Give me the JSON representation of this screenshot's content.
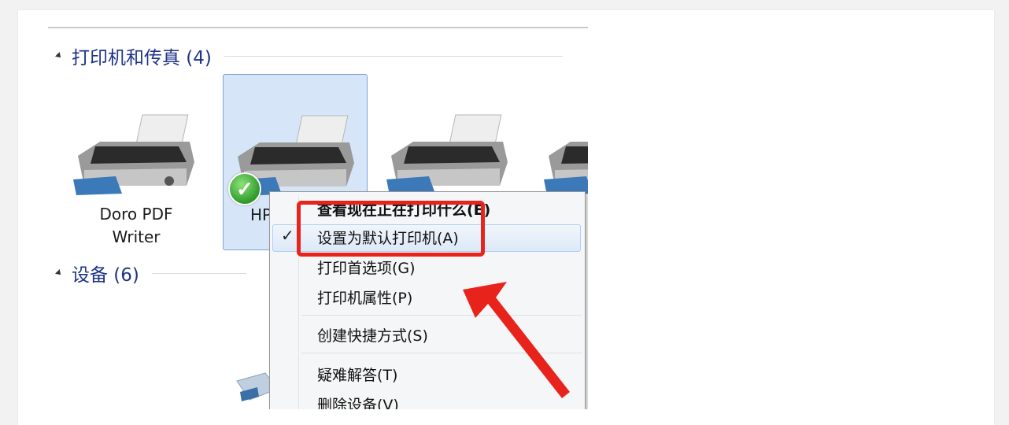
{
  "groups": {
    "printers": {
      "title": "打印机和传真 (4)"
    },
    "devices": {
      "title": "设备 (6)"
    }
  },
  "printers": [
    {
      "label_line1": "Doro PDF",
      "label_line2": "Writer"
    },
    {
      "label_line1": "HP",
      "label_line2": "",
      "default": true,
      "selected": true
    },
    {
      "label_line1": "",
      "label_line2": ""
    },
    {
      "label_line1": "",
      "label_line2": ""
    }
  ],
  "context_menu": {
    "items": [
      {
        "label": "查看现在正在打印什么(E)"
      },
      {
        "label": "设置为默认打印机(A)",
        "checked": true,
        "highlighted": true
      },
      {
        "label": "打印首选项(G)"
      },
      {
        "label": "打印机属性(P)"
      },
      {
        "label": "创建快捷方式(S)"
      },
      {
        "label": "疑难解答(T)"
      },
      {
        "label": "删除设备(V)"
      }
    ],
    "check_glyph": "✓"
  },
  "annotation": {
    "box_color": "#e8231c",
    "arrow_color": "#e8231c"
  },
  "icons": {
    "default_badge": "✓"
  }
}
